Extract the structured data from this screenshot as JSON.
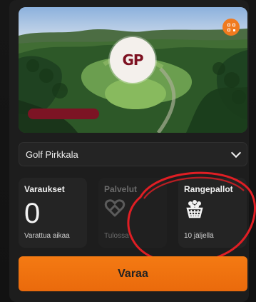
{
  "header": {
    "logo_text": "GP",
    "qr_icon": "qr-code-icon"
  },
  "club_selector": {
    "selected": "Golf Pirkkala",
    "icon": "chevron-down-icon"
  },
  "tiles": [
    {
      "title": "Varaukset",
      "value": "0",
      "subtitle": "Varattua aikaa"
    },
    {
      "title": "Palvelut",
      "icon": "heart-link-icon",
      "subtitle": "Tulossa"
    },
    {
      "title": "Rangepallot",
      "icon": "range-balls-basket-icon",
      "subtitle": "10 jäljellä"
    }
  ],
  "book_button": {
    "label": "Varaa"
  },
  "colors": {
    "accent": "#f07a1e",
    "primary_button": "#f47a13",
    "annotation_red": "#e01e24",
    "brand": "#7c1424"
  }
}
